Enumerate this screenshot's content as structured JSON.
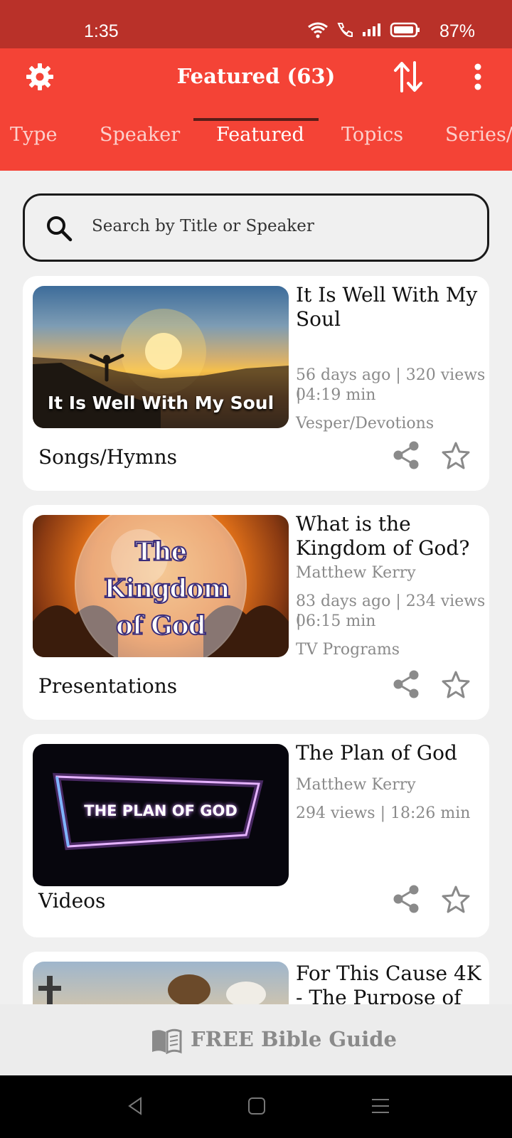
{
  "status": {
    "time": "1:35",
    "battery": "87%"
  },
  "header": {
    "title": "Featured (63)",
    "tabs": [
      "Type",
      "Speaker",
      "Featured",
      "Topics",
      "Series/C"
    ]
  },
  "search": {
    "placeholder": "Search by Title or Speaker"
  },
  "items": [
    {
      "title": "It Is Well With My Soul",
      "thumb_text": "It Is Well With My Soul",
      "speaker": "",
      "meta": "56 days ago | 320 views | 04:19 min",
      "meta_line1": "56 days ago | 320 views |",
      "meta_line2": "04:19 min",
      "type": "Vesper/Devotions",
      "category": "Songs/Hymns"
    },
    {
      "title": "What is the Kingdom of God?",
      "thumb_text": "The Kingdom of God",
      "speaker": "Matthew Kerry",
      "meta_line1": "83 days ago | 234 views |",
      "meta_line2": "06:15 min",
      "type": "TV Programs",
      "category": "Presentations"
    },
    {
      "title": "The Plan of God",
      "thumb_text": "THE PLAN OF GOD",
      "speaker": "Matthew Kerry",
      "meta_line1": "294 views | 18:26 min",
      "category": "Videos"
    },
    {
      "title": "For This Cause 4K - The Purpose of"
    }
  ],
  "banner": {
    "label": "FREE Bible Guide"
  },
  "colors": {
    "primary": "#f44336",
    "status_bar": "#b93129"
  }
}
